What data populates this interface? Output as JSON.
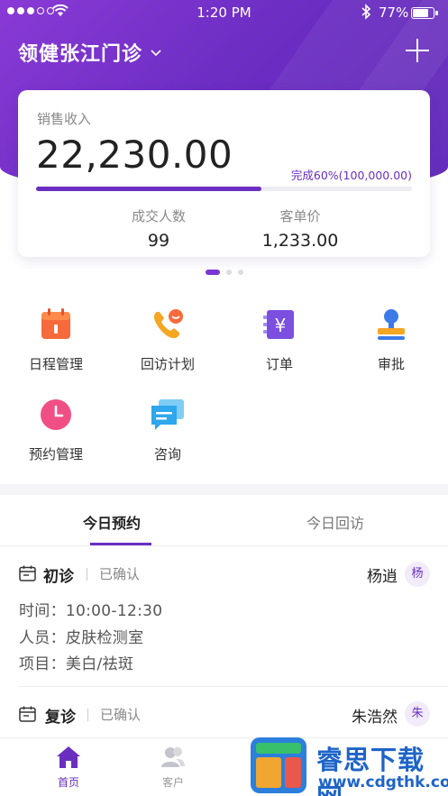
{
  "status_bar": {
    "time": "1:20 PM",
    "battery": "77%"
  },
  "header": {
    "clinic_name": "领健张江门诊",
    "dropdown_icon": "chevron-down-icon",
    "add_icon": "plus-icon"
  },
  "sales_card": {
    "label": "销售收入",
    "amount": "22,230.00",
    "progress_text": "完成60%(100,000.00)",
    "progress_fraction": 0.6,
    "stats": [
      {
        "label": "成交人数",
        "value": "99"
      },
      {
        "label": "客单价",
        "value": "1,233.00"
      }
    ]
  },
  "carousel": {
    "pages": 3,
    "active": 0
  },
  "menu": [
    {
      "label": "日程管理",
      "icon": "calendar-icon"
    },
    {
      "label": "回访计划",
      "icon": "phone-callback-icon"
    },
    {
      "label": "订单",
      "icon": "yuan-order-icon"
    },
    {
      "label": "审批",
      "icon": "stamp-approval-icon"
    },
    {
      "label": "预约管理",
      "icon": "clock-icon"
    },
    {
      "label": "咨询",
      "icon": "chat-icon"
    }
  ],
  "tabs": [
    {
      "label": "今日预约",
      "active": true
    },
    {
      "label": "今日回访",
      "active": false
    }
  ],
  "appointments": [
    {
      "type": "初诊",
      "status": "已确认",
      "patient": "杨逍",
      "avatar": "杨",
      "time_label": "时间：",
      "time": "10:00-12:30",
      "staff_label": "人员：",
      "staff": "皮肤检测室",
      "item_label": "项目：",
      "item": "美白/祛斑"
    },
    {
      "type": "复诊",
      "status": "已确认",
      "patient": "朱浩然",
      "avatar": "朱"
    }
  ],
  "bottom_nav": [
    {
      "label": "首页",
      "icon": "home-icon",
      "active": true
    },
    {
      "label": "客户",
      "icon": "customers-icon",
      "active": false
    }
  ],
  "watermark": {
    "title": "睿思下载网",
    "url": "www.cdgthk.com"
  },
  "colors": {
    "brand": "#6a2fc0",
    "hero_start": "#8a3ad6",
    "hero_end": "#5a22b6"
  }
}
